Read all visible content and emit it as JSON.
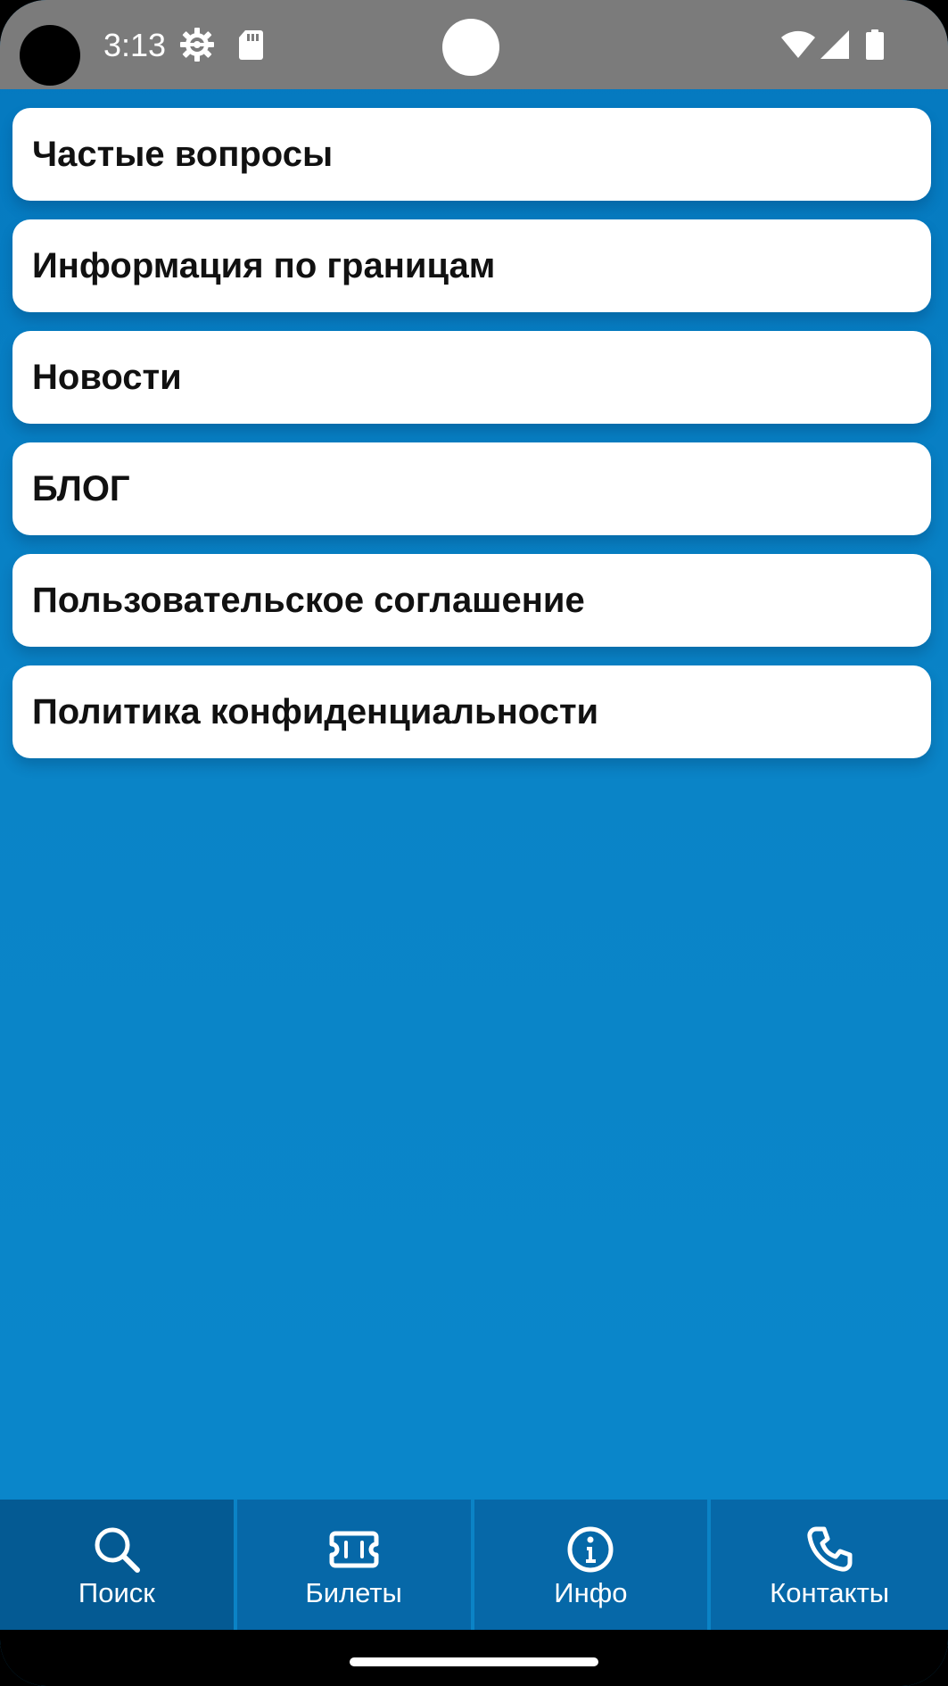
{
  "status_bar": {
    "time": "3:13",
    "icons": [
      "settings-icon",
      "sd-card-icon",
      "wifi-icon",
      "cellular-signal-icon",
      "battery-icon"
    ]
  },
  "menu": {
    "items": [
      {
        "label": "Частые вопросы"
      },
      {
        "label": "Информация по границам"
      },
      {
        "label": "Новости"
      },
      {
        "label": "БЛОГ"
      },
      {
        "label": "Пользовательское соглашение"
      },
      {
        "label": "Политика конфиденциальности"
      }
    ]
  },
  "bottom_nav": {
    "items": [
      {
        "label": "Поиск",
        "icon": "search-icon"
      },
      {
        "label": "Билеты",
        "icon": "ticket-icon"
      },
      {
        "label": "Инфо",
        "icon": "info-icon"
      },
      {
        "label": "Контакты",
        "icon": "phone-icon"
      }
    ],
    "selected": "Поиск"
  },
  "colors": {
    "page_background": "#0a84c7",
    "status_bar": "#7b7b7b",
    "card_background": "#ffffff",
    "bottom_nav": "#0668a8",
    "bottom_nav_active": "#045a93",
    "text_dark": "#111111",
    "text_light": "#ffffff"
  }
}
